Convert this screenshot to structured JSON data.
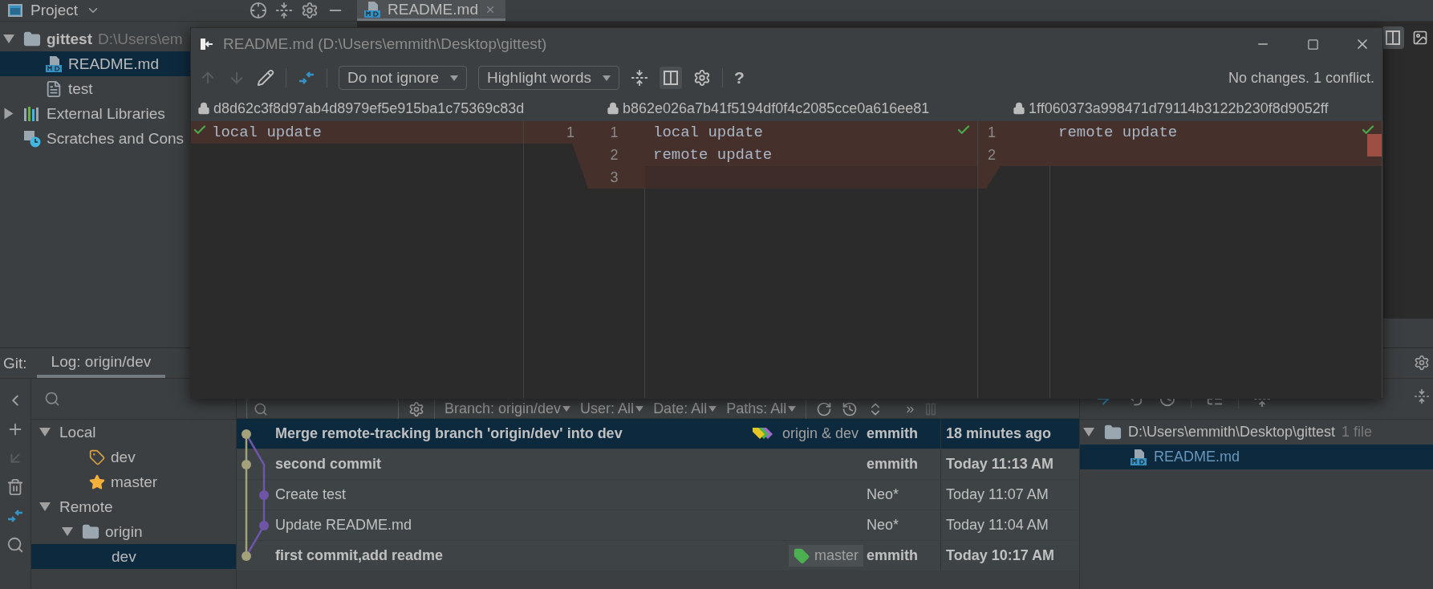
{
  "top_bar": {
    "project_label": "Project",
    "editor_tab": {
      "label": "README.md",
      "selected": true
    }
  },
  "project_tree": [
    {
      "label": "gittest",
      "path": "D:\\Users\\em",
      "kind": "folder",
      "expanded": true,
      "selected": false,
      "children": [
        {
          "label": "README.md",
          "kind": "markdown",
          "selected": true
        },
        {
          "label": "test",
          "kind": "file",
          "selected": false
        }
      ]
    },
    {
      "label": "External Libraries",
      "kind": "library",
      "expanded": false,
      "selected": false
    },
    {
      "label": "Scratches and Cons",
      "kind": "scratches",
      "selected": false
    }
  ],
  "merge_dialog": {
    "title": "README.md (D:\\Users\\emmith\\Desktop\\gittest)",
    "ignore_dropdown": "Do not ignore",
    "highlight_dropdown": "Highlight words",
    "help": "?",
    "status": "No changes. 1 conflict.",
    "side_by_side_on": true,
    "panes": [
      {
        "revision": "d8d62c3f8d97ab4d8979ef5e915ba1c75369c83d",
        "lines": [
          {
            "number": "1",
            "text": "local update"
          }
        ]
      },
      {
        "revision": "b862e026a7b41f5194df0f4c2085cce0a616ee81",
        "lines": [
          {
            "number": "1",
            "text": "local update"
          },
          {
            "number": "2",
            "text": "remote update"
          },
          {
            "number": "3"
          }
        ]
      },
      {
        "revision": "1ff060373a998471d79114b3122b230f8d9052ff",
        "lines": [
          {
            "number": "1",
            "text": "remote update"
          },
          {
            "number": "2"
          }
        ]
      }
    ]
  },
  "git_panel": {
    "label": "Git:",
    "tabs": [
      {
        "label": "Log: origin/dev",
        "selected": true
      }
    ],
    "branches": [
      {
        "label": "Local",
        "expanded": true,
        "selected": false,
        "children": [
          {
            "label": "dev",
            "kind": "tag",
            "selected": false
          },
          {
            "label": "master",
            "kind": "star",
            "selected": false
          }
        ]
      },
      {
        "label": "Remote",
        "expanded": true,
        "selected": false,
        "children": [
          {
            "label": "origin",
            "kind": "folder",
            "expanded": true,
            "selected": false,
            "children": [
              {
                "label": "dev",
                "kind": "branch",
                "selected": true
              }
            ]
          }
        ]
      }
    ],
    "filters": [
      "Branch: origin/dev",
      "User: All",
      "Date: All",
      "Paths: All"
    ],
    "more": "»",
    "commits": [
      {
        "message": "Merge remote-tracking branch 'origin/dev' into dev",
        "bold": true,
        "kind": "mainline",
        "refs": {
          "label": "origin & dev",
          "kind": "multiple"
        },
        "author": "emmith",
        "date": "18 minutes ago",
        "selected": true
      },
      {
        "message": "second commit",
        "bold": true,
        "kind": "mainline",
        "author": "emmith",
        "date": "Today 11:13 AM",
        "selected": false
      },
      {
        "message": "Create test",
        "bold": false,
        "kind": "side",
        "author": "Neo*",
        "date": "Today 11:07 AM",
        "selected": false
      },
      {
        "message": "Update README.md",
        "bold": false,
        "kind": "side",
        "author": "Neo*",
        "date": "Today 11:04 AM",
        "selected": false
      },
      {
        "message": "first commit,add readme",
        "bold": true,
        "kind": "mainline",
        "refs": {
          "label": "master",
          "kind": "single"
        },
        "author": "emmith",
        "date": "Today 10:17 AM",
        "selected": false
      }
    ],
    "changed_files": [
      {
        "label": "D:\\Users\\emmith\\Desktop\\gittest",
        "count": "1 file",
        "expanded": true,
        "selected": false,
        "children": [
          {
            "label": "README.md",
            "selected": true
          }
        ]
      }
    ]
  }
}
